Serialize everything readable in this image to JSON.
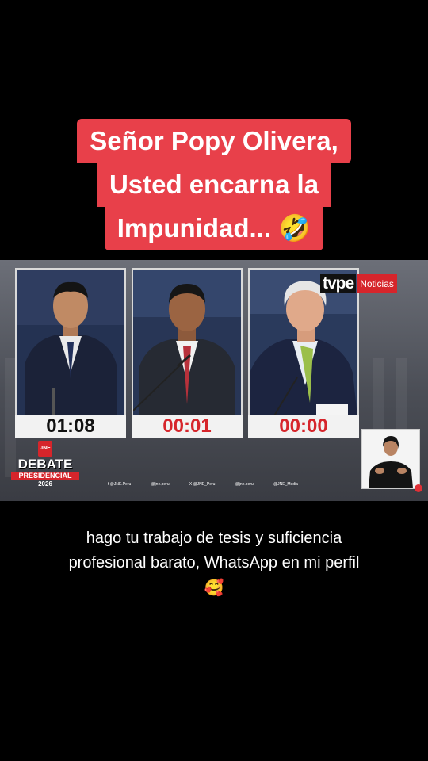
{
  "caption": {
    "line1": "Señor Popy Olivera,",
    "line2": "Usted encarna la",
    "line3": "Impunidad...",
    "emoji": "🤣"
  },
  "video": {
    "broadcaster": {
      "logo": "tvpe",
      "label": "Noticias"
    },
    "timers": [
      "01:08",
      "00:01",
      "00:00"
    ],
    "event": {
      "title": "DEBATE",
      "subtitle": "PRESIDENCIAL",
      "year": "2026",
      "mark": "JNE"
    },
    "social": [
      "f @JNE.Peru",
      "@jne.peru",
      "X @JNE_Peru",
      "@jne.peru",
      "@JNE_Media"
    ],
    "colors": {
      "accent": "#d6252b",
      "caption_bg": "#e8404a"
    }
  },
  "subtitle": {
    "line1": "hago tu trabajo de tesis y suficiencia",
    "line2": "profesional barato, WhatsApp en mi perfil",
    "emoji": "🥰"
  }
}
